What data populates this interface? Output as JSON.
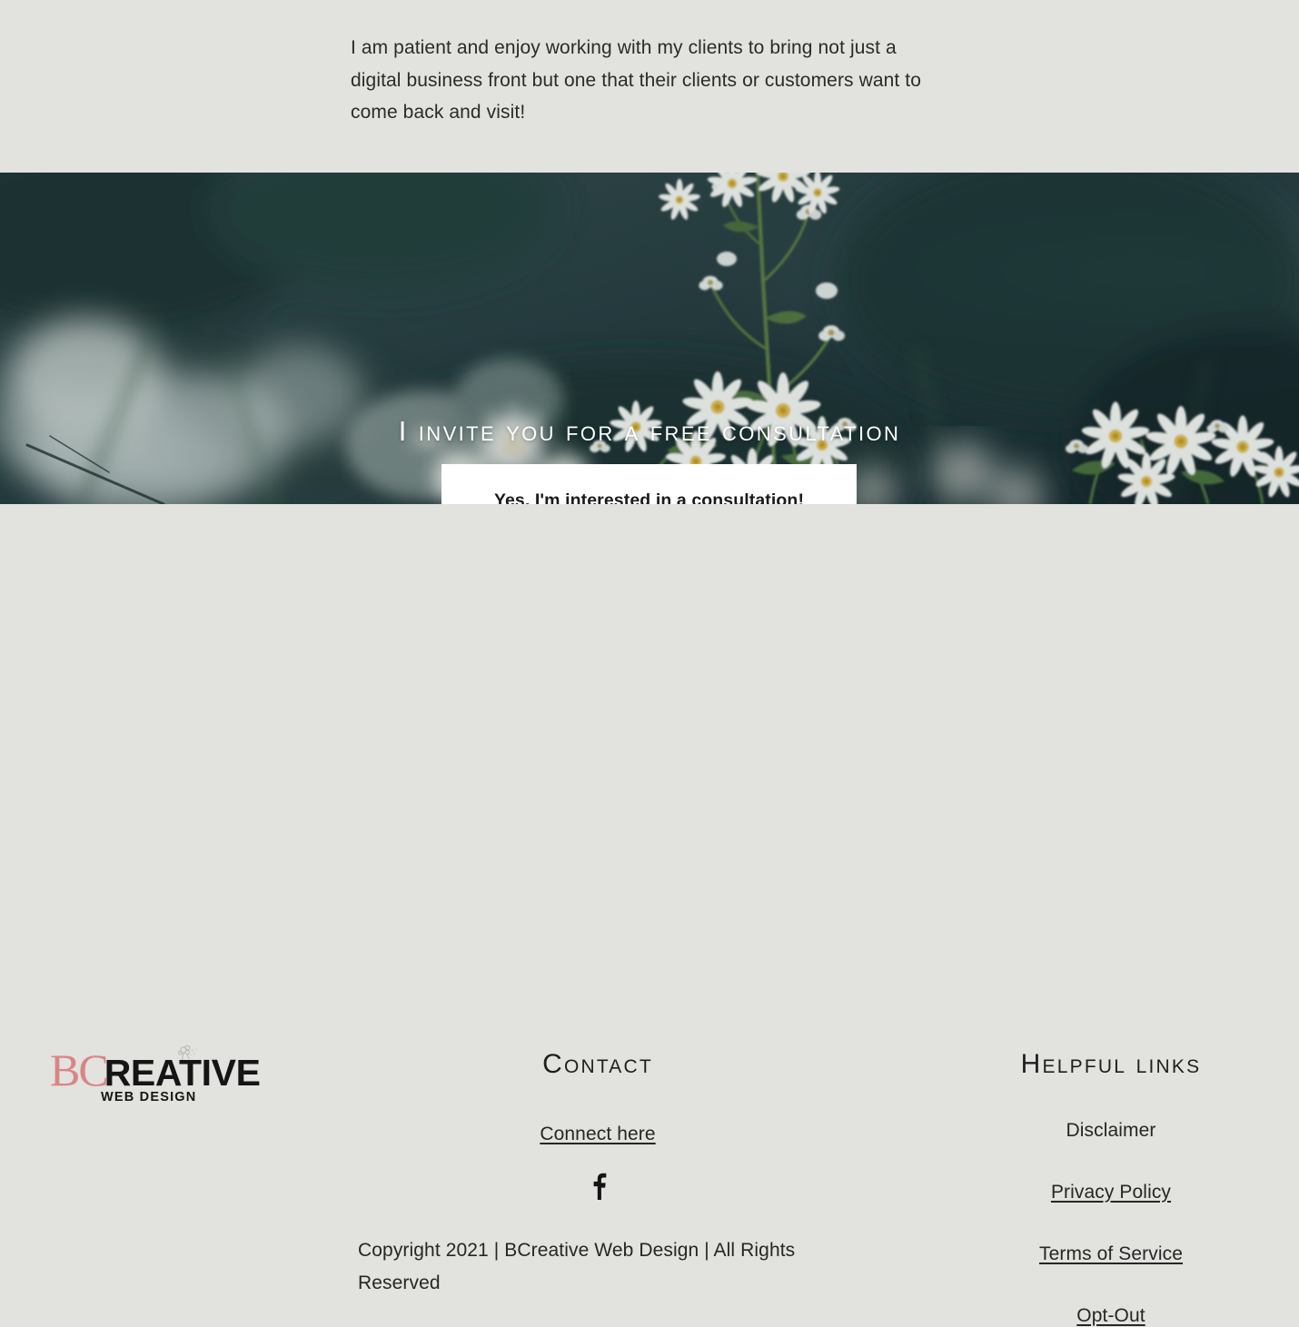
{
  "page": {
    "background_color": "#E2E2DE",
    "text_color": "#2A2A2A"
  },
  "intro": {
    "paragraph": "I am patient and enjoy working with my clients to bring not just a digital business front but one that their clients or customers want to come back and visit!"
  },
  "hero": {
    "heading": "I invite you for a free consultation",
    "cta_label": "Yes, I'm interested in a consultation!",
    "cta_background": "#FFFFFF",
    "heading_color": "#FFFFFF",
    "photo_description": "blurred white daisy wildflowers on dark teal green background",
    "photo_colors": {
      "dark_teal": "#2B4246",
      "deep_green": "#1E3330",
      "haze": "#B9C3C2",
      "petal_white": "#F2F4F2",
      "flower_center": "#E3C24A",
      "stem_green": "#53773F"
    }
  },
  "footer": {
    "logo": {
      "mark": "BC",
      "mark_color": "#D98585",
      "word": "REATIVE",
      "tagline": "WEB DESIGN",
      "flower_icon": "flower-sprig-icon"
    },
    "contact": {
      "heading": "Contact",
      "link_label": "Connect here",
      "social": [
        {
          "name": "facebook-icon",
          "label": "Facebook"
        }
      ],
      "copyright": "Copyright 2021 | BCreative Web Design | All Rights Reserved"
    },
    "helpful_links": {
      "heading": "Helpful Links",
      "items": [
        {
          "label": "Disclaimer",
          "underlined": false
        },
        {
          "label": "Privacy Policy",
          "underlined": true
        },
        {
          "label": "Terms of Service",
          "underlined": true
        },
        {
          "label": "Opt-Out",
          "underlined": true
        }
      ]
    }
  }
}
